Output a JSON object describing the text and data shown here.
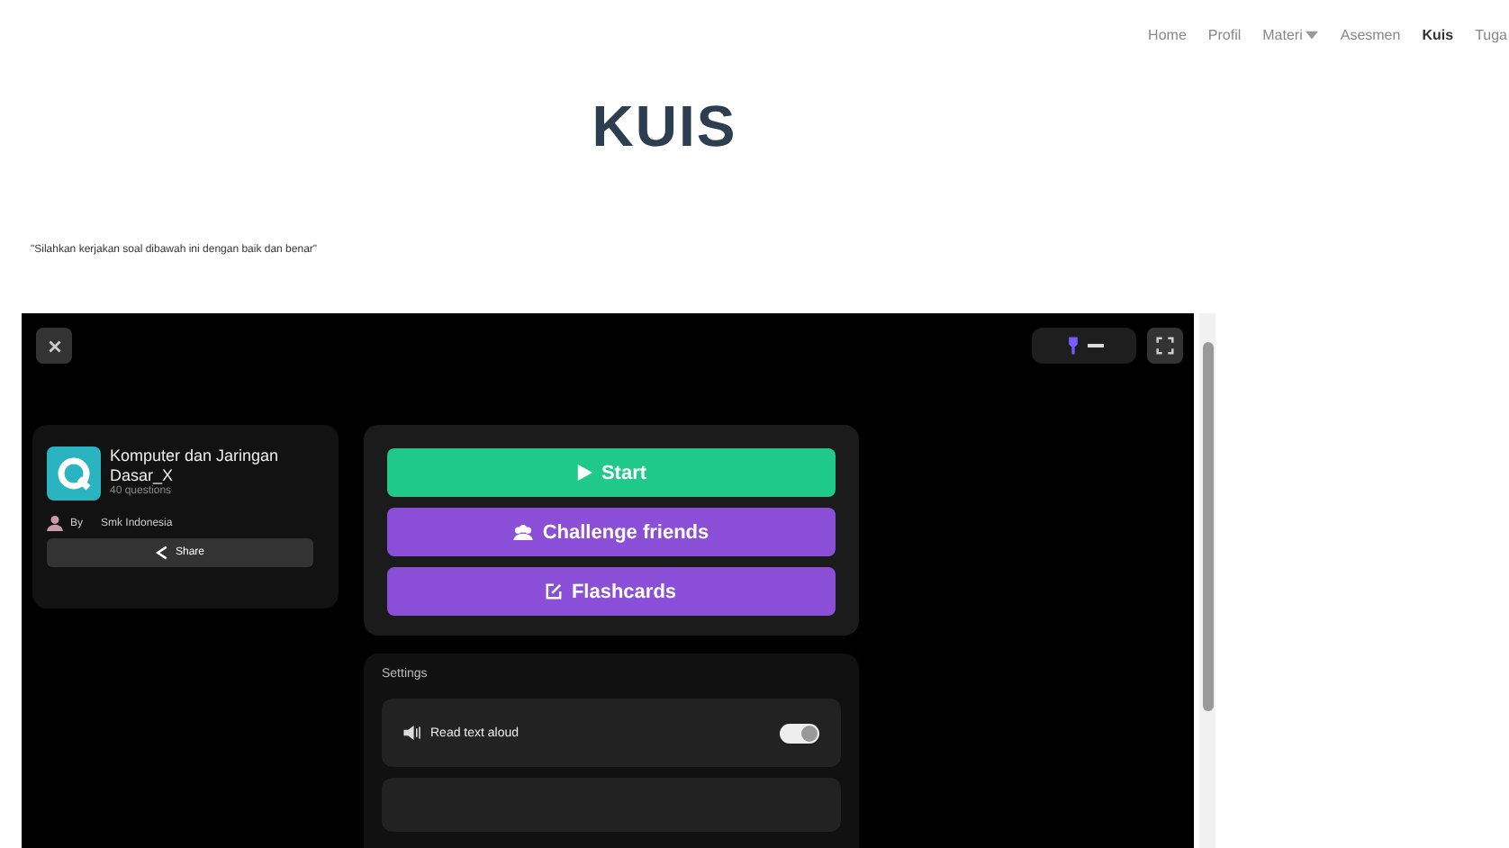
{
  "nav": [
    {
      "label": "Home",
      "selected": false,
      "dropdown": false
    },
    {
      "label": "Profil",
      "selected": false,
      "dropdown": false
    },
    {
      "label": "Materi",
      "selected": false,
      "dropdown": true
    },
    {
      "label": "Asesmen",
      "selected": false,
      "dropdown": false
    },
    {
      "label": "Kuis",
      "selected": true,
      "dropdown": false
    },
    {
      "label": "Tuga",
      "selected": false,
      "dropdown": false
    }
  ],
  "title": "KUIS",
  "instruction": "\"Silahkan kerjakan soal dibawah ini dengan baik dan benar\"",
  "quiz": {
    "title": "Komputer dan Jaringan Dasar_X",
    "count": "40 questions",
    "author_prefix": "By",
    "author": "Smk Indonesia",
    "share": "Share"
  },
  "actions": [
    {
      "label": "Start",
      "kind": "start"
    },
    {
      "label": "Challenge friends",
      "kind": "challenge"
    },
    {
      "label": "Flashcards",
      "kind": "flashcards"
    }
  ],
  "settings": {
    "heading": "Settings",
    "items": [
      {
        "label": "Read text aloud",
        "on": true
      }
    ]
  }
}
